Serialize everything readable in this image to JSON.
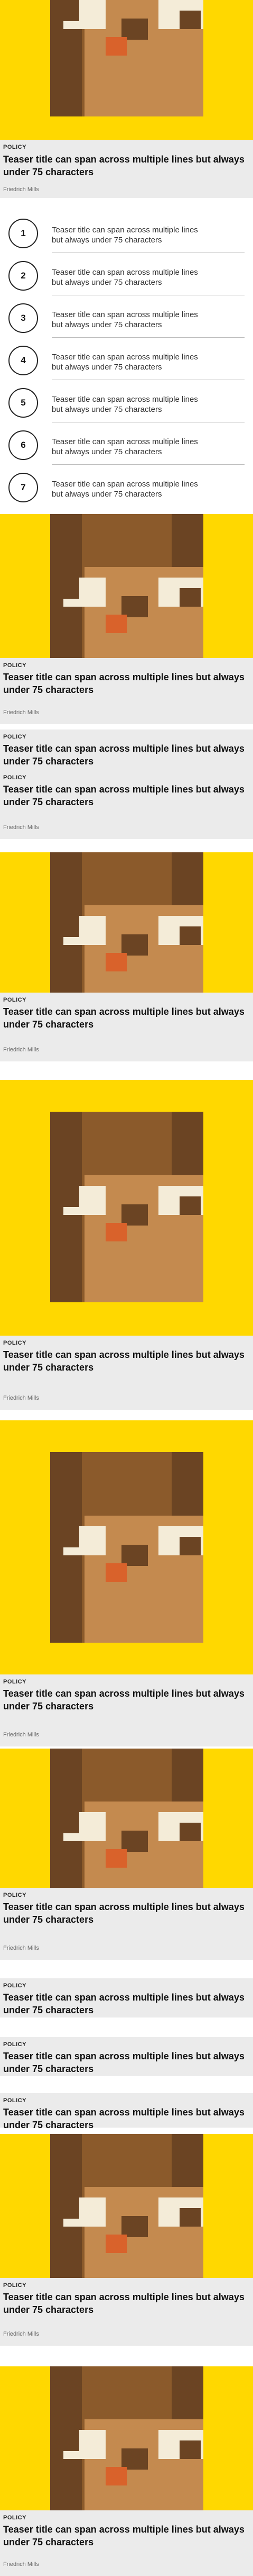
{
  "colors": {
    "brand_yellow": "#ffd800",
    "card_bg": "#ebebeb",
    "brown_dark": "#6b4423",
    "brown_mid": "#8b5a2b",
    "brown_light": "#c48a4f",
    "eye_white": "#f4ecd8",
    "nose": "#d9622b"
  },
  "icons": {
    "hero": "bear-mascot-image"
  },
  "top_teaser": {
    "label": "POLICY",
    "title": "Teaser title can span across multiple lines but always under 75 characters",
    "author": "Friedrich Mills"
  },
  "numbered_list": [
    {
      "number": "1",
      "text": "Teaser title can span across multiple lines but always under 75 characters"
    },
    {
      "number": "2",
      "text": "Teaser title can span across multiple lines but always under 75 characters"
    },
    {
      "number": "3",
      "text": "Teaser title can span across multiple lines but always under 75 characters"
    },
    {
      "number": "4",
      "text": "Teaser title can span across multiple lines but always under 75 characters"
    },
    {
      "number": "5",
      "text": "Teaser title can span across multiple lines but always under 75 characters"
    },
    {
      "number": "6",
      "text": "Teaser title can span across multiple lines but always under 75 characters"
    },
    {
      "number": "7",
      "text": "Teaser title can span across multiple lines but always under 75 characters"
    }
  ],
  "teasers": [
    {
      "label": "POLICY",
      "title": "Teaser title can span across multiple lines but always under 75 characters",
      "author": "Friedrich Mills"
    },
    {
      "label": "POLICY",
      "title": "Teaser title can span across multiple lines but always under 75 characters"
    },
    {
      "label": "POLICY",
      "title": "Teaser title can span across multiple lines but always under 75 characters",
      "author": "Friedrich Mills"
    },
    {
      "label": "POLICY",
      "title": "Teaser title can span across multiple lines but always under 75 characters",
      "author": "Friedrich Mills"
    },
    {
      "label": "POLICY",
      "title": "Teaser title can span across multiple lines but always under 75 characters",
      "author": "Friedrich Mills"
    },
    {
      "label": "POLICY",
      "title": "Teaser title can span across multiple lines but always under 75 characters",
      "author": "Friedrich Mills"
    },
    {
      "label": "POLICY",
      "title": "Teaser title can span across multiple lines but always under 75 characters",
      "author": "Friedrich Mills"
    },
    {
      "label": "POLICY",
      "title": "Teaser title can span across multiple lines but always under 75 characters"
    },
    {
      "label": "POLICY",
      "title": "Teaser title can span across multiple lines but always under 75 characters"
    },
    {
      "label": "POLICY",
      "title": "Teaser title can span across multiple lines but always under 75 characters"
    },
    {
      "label": "POLICY",
      "title": "Teaser title can span across multiple lines but always under 75 characters",
      "author": "Friedrich Mills"
    },
    {
      "label": "POLICY",
      "title": "Teaser title can span across multiple lines but always under 75 characters",
      "author": "Friedrich Mills"
    }
  ]
}
